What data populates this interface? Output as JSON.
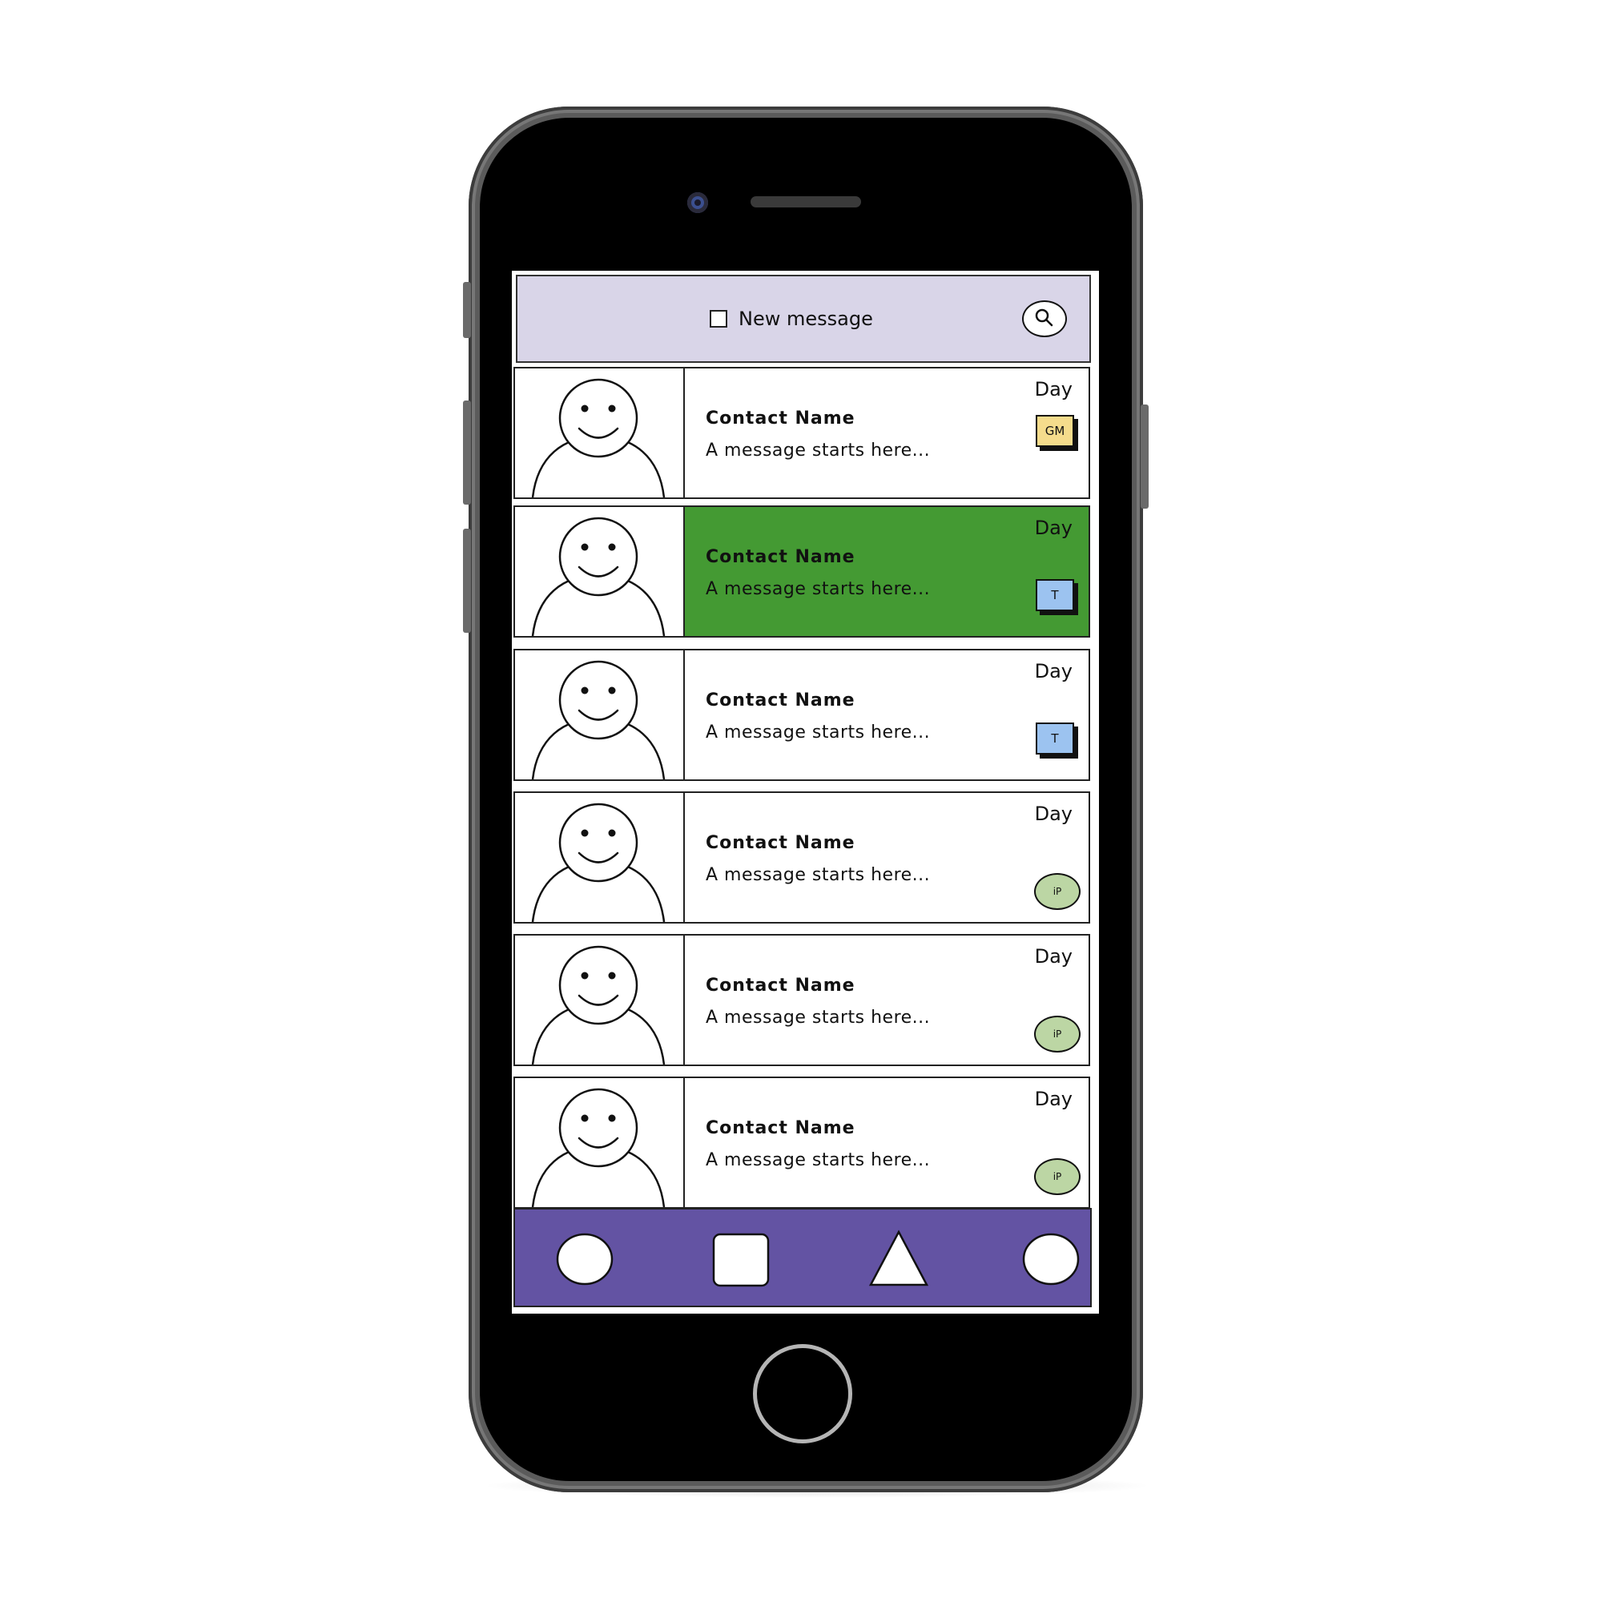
{
  "header": {
    "new_message_label": "New message",
    "search_icon": "search-icon"
  },
  "messages": [
    {
      "name": "Contact Name",
      "preview": "A message starts here...",
      "day": "Day",
      "badge": "GM",
      "badge_shape": "square",
      "badge_color": "#f5dc8c",
      "selected": false
    },
    {
      "name": "Contact Name",
      "preview": "A message starts here...",
      "day": "Day",
      "badge": "T",
      "badge_shape": "square",
      "badge_color": "#9cc3f0",
      "selected": true
    },
    {
      "name": "Contact Name",
      "preview": "A message starts here...",
      "day": "Day",
      "badge": "T",
      "badge_shape": "square",
      "badge_color": "#9cc3f0",
      "selected": false
    },
    {
      "name": "Contact Name",
      "preview": "A message starts here...",
      "day": "Day",
      "badge": "iP",
      "badge_shape": "round",
      "badge_color": "#bcd6a4",
      "selected": false
    },
    {
      "name": "Contact Name",
      "preview": "A message starts here...",
      "day": "Day",
      "badge": "iP",
      "badge_shape": "round",
      "badge_color": "#bcd6a4",
      "selected": false
    },
    {
      "name": "Contact Name",
      "preview": "A message starts here...",
      "day": "Day",
      "badge": "iP",
      "badge_shape": "round",
      "badge_color": "#bcd6a4",
      "selected": false
    }
  ],
  "bottom_nav": [
    {
      "icon": "circle-icon"
    },
    {
      "icon": "square-icon"
    },
    {
      "icon": "triangle-icon"
    },
    {
      "icon": "circle-icon"
    }
  ],
  "colors": {
    "header_bg": "#d9d5e8",
    "selected_row_bg": "#449a33",
    "bottom_bar_bg": "#6353a3"
  }
}
